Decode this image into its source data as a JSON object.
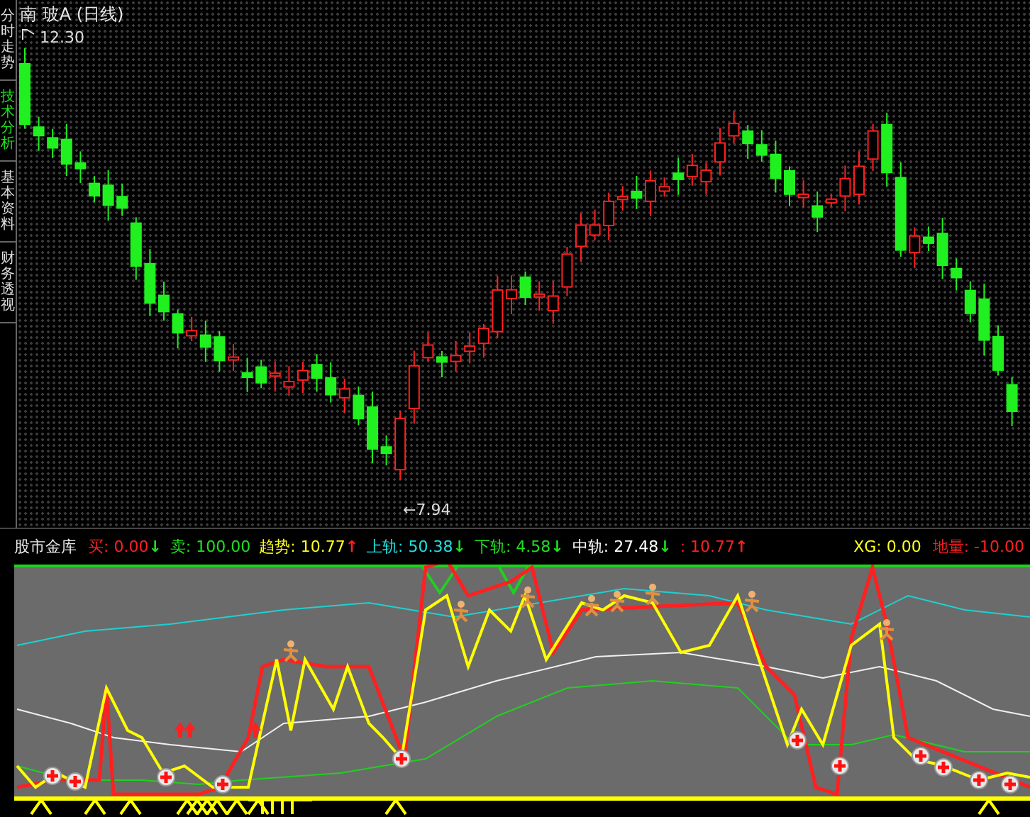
{
  "chart": {
    "title": "南  玻A (日线)",
    "high_label": "12.30",
    "low_label": "←7.94"
  },
  "tabs": [
    {
      "label": "分时走势",
      "selected": false
    },
    {
      "label": "技术分析",
      "selected": true
    },
    {
      "label": "基本资料",
      "selected": false
    },
    {
      "label": "财务透视",
      "selected": false
    }
  ],
  "indicator": {
    "name": "股市金库",
    "legend": [
      {
        "text": "买: 0.00",
        "color": "#ff2020",
        "arrow": "↓",
        "rising": false
      },
      {
        "text": "卖: 100.00",
        "color": "#20e020"
      },
      {
        "text": "趋势: 10.77",
        "color": "#ffff20",
        "arrow": "↑",
        "rising": true
      },
      {
        "text": "上轨: 50.38",
        "color": "#20e0e0",
        "arrow": "↓",
        "rising": false
      },
      {
        "text": "下轨: 4.58",
        "color": "#20e020",
        "arrow": "↓",
        "rising": false
      },
      {
        "text": "中轨: 27.48",
        "color": "#ffffff",
        "arrow": "↓",
        "rising": false
      },
      {
        "text": ": 10.77",
        "color": "#ff2020",
        "arrow": "↑",
        "rising": true
      }
    ],
    "signals": [
      {
        "text": "XG: 0.00",
        "color": "#ffff20"
      },
      {
        "text": "地量: -10.00",
        "color": "#ff2020"
      }
    ]
  }
}
